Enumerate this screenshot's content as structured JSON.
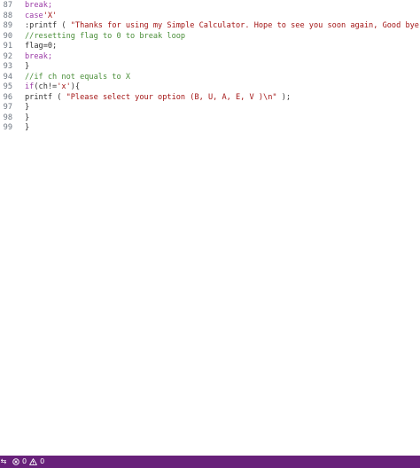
{
  "editor": {
    "lines": [
      {
        "number": "87",
        "tokens": [
          {
            "text": "break;",
            "cls": "kw"
          }
        ]
      },
      {
        "number": "88",
        "tokens": [
          {
            "text": "case",
            "cls": "kw"
          },
          {
            "text": "'X'",
            "cls": "str"
          }
        ]
      },
      {
        "number": "89",
        "tokens": [
          {
            "text": ":printf ( ",
            "cls": "pl"
          },
          {
            "text": "\"Thanks for using my Simple Calculator. Hope to see you soon again, Good bye !\\n\"",
            "cls": "str"
          },
          {
            "text": " );",
            "cls": "pl"
          }
        ]
      },
      {
        "number": "90",
        "tokens": [
          {
            "text": "//resetting flag to 0 to break loop",
            "cls": "cm"
          }
        ]
      },
      {
        "number": "91",
        "tokens": [
          {
            "text": "flag=0;",
            "cls": "pl"
          }
        ]
      },
      {
        "number": "92",
        "tokens": [
          {
            "text": "break;",
            "cls": "kw"
          }
        ]
      },
      {
        "number": "93",
        "tokens": [
          {
            "text": "}",
            "cls": "pl"
          }
        ]
      },
      {
        "number": "94",
        "tokens": [
          {
            "text": "//if ch not equals to X",
            "cls": "cm"
          }
        ]
      },
      {
        "number": "95",
        "tokens": [
          {
            "text": "if",
            "cls": "kw"
          },
          {
            "text": "(ch!=",
            "cls": "pl"
          },
          {
            "text": "'x'",
            "cls": "str"
          },
          {
            "text": "){",
            "cls": "pl"
          }
        ]
      },
      {
        "number": "96",
        "tokens": [
          {
            "text": "printf ( ",
            "cls": "pl"
          },
          {
            "text": "\"Please select your option (B, U, A, E, V )\\n\"",
            "cls": "str"
          },
          {
            "text": " );",
            "cls": "pl"
          }
        ]
      },
      {
        "number": "97",
        "tokens": [
          {
            "text": "}",
            "cls": "pl"
          }
        ]
      },
      {
        "number": "98",
        "tokens": [
          {
            "text": "}",
            "cls": "pl"
          }
        ]
      },
      {
        "number": "99",
        "tokens": [
          {
            "text": "}",
            "cls": "pl"
          }
        ]
      }
    ]
  },
  "statusbar": {
    "remote_glyph": "⇆",
    "errors_count": "0",
    "warnings_count": "0",
    "background": "#68217a"
  },
  "icons": {
    "remote": "remote-indicator-icon",
    "errors": "error-circle-icon",
    "warnings": "warning-triangle-icon"
  }
}
